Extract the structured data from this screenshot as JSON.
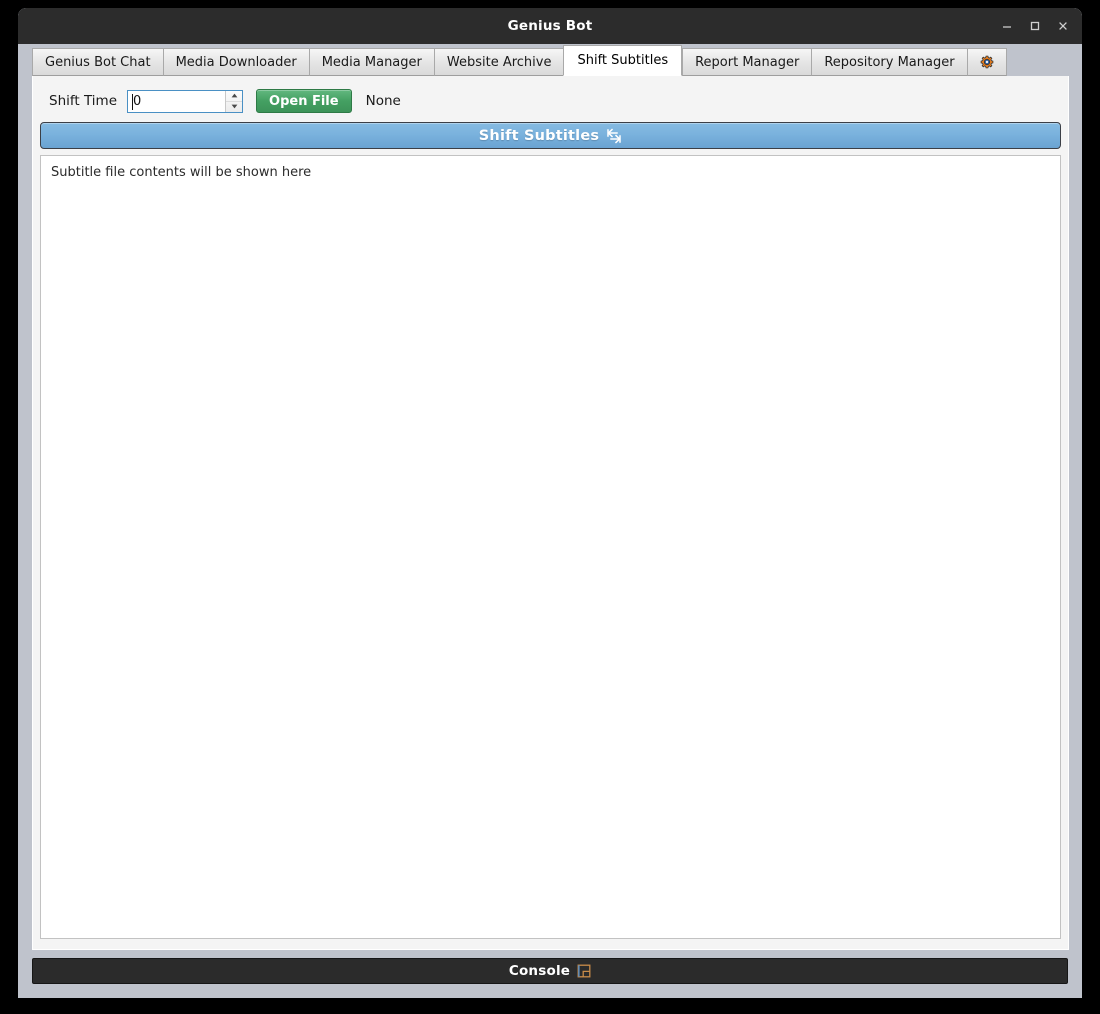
{
  "window": {
    "title": "Genius Bot",
    "controls": [
      {
        "name": "minimize-button",
        "icon": "minimize-icon",
        "label": "–"
      },
      {
        "name": "maximize-button",
        "icon": "maximize-icon",
        "label": "□"
      },
      {
        "name": "close-button",
        "icon": "close-icon",
        "label": "×"
      }
    ]
  },
  "tabs": [
    {
      "label": "Genius Bot Chat",
      "active": false
    },
    {
      "label": "Media Downloader",
      "active": false
    },
    {
      "label": "Media Manager",
      "active": false
    },
    {
      "label": "Website Archive",
      "active": false
    },
    {
      "label": "Shift Subtitles",
      "active": true
    },
    {
      "label": "Report Manager",
      "active": false
    },
    {
      "label": "Repository Manager",
      "active": false
    }
  ],
  "settings_tab": {
    "icon": "gear-icon",
    "label": ""
  },
  "toolbar": {
    "shift_time_label": "Shift Time",
    "shift_time_value": "0",
    "shift_time_placeholder": "0",
    "open_file_label": "Open File",
    "file_status": "None"
  },
  "banner": {
    "label": "Shift Subtitles",
    "icon": "shift-arrows-icon",
    "icon_glyph": "↹"
  },
  "subtitle_view": {
    "placeholder": "Subtitle file contents will be shown here",
    "content": ""
  },
  "console": {
    "label": "Console",
    "icon": "panel-toggle-icon"
  },
  "colors": {
    "titlebar_bg": "#2c2c2c",
    "window_bg": "#bfc3cc",
    "content_bg": "#f4f4f4",
    "active_tab_bg": "#ffffff",
    "banner_blue": "#7ab2dd",
    "open_file_green": "#44a062",
    "console_bg": "#2b2b2b",
    "focus_border": "#4a90c4"
  }
}
